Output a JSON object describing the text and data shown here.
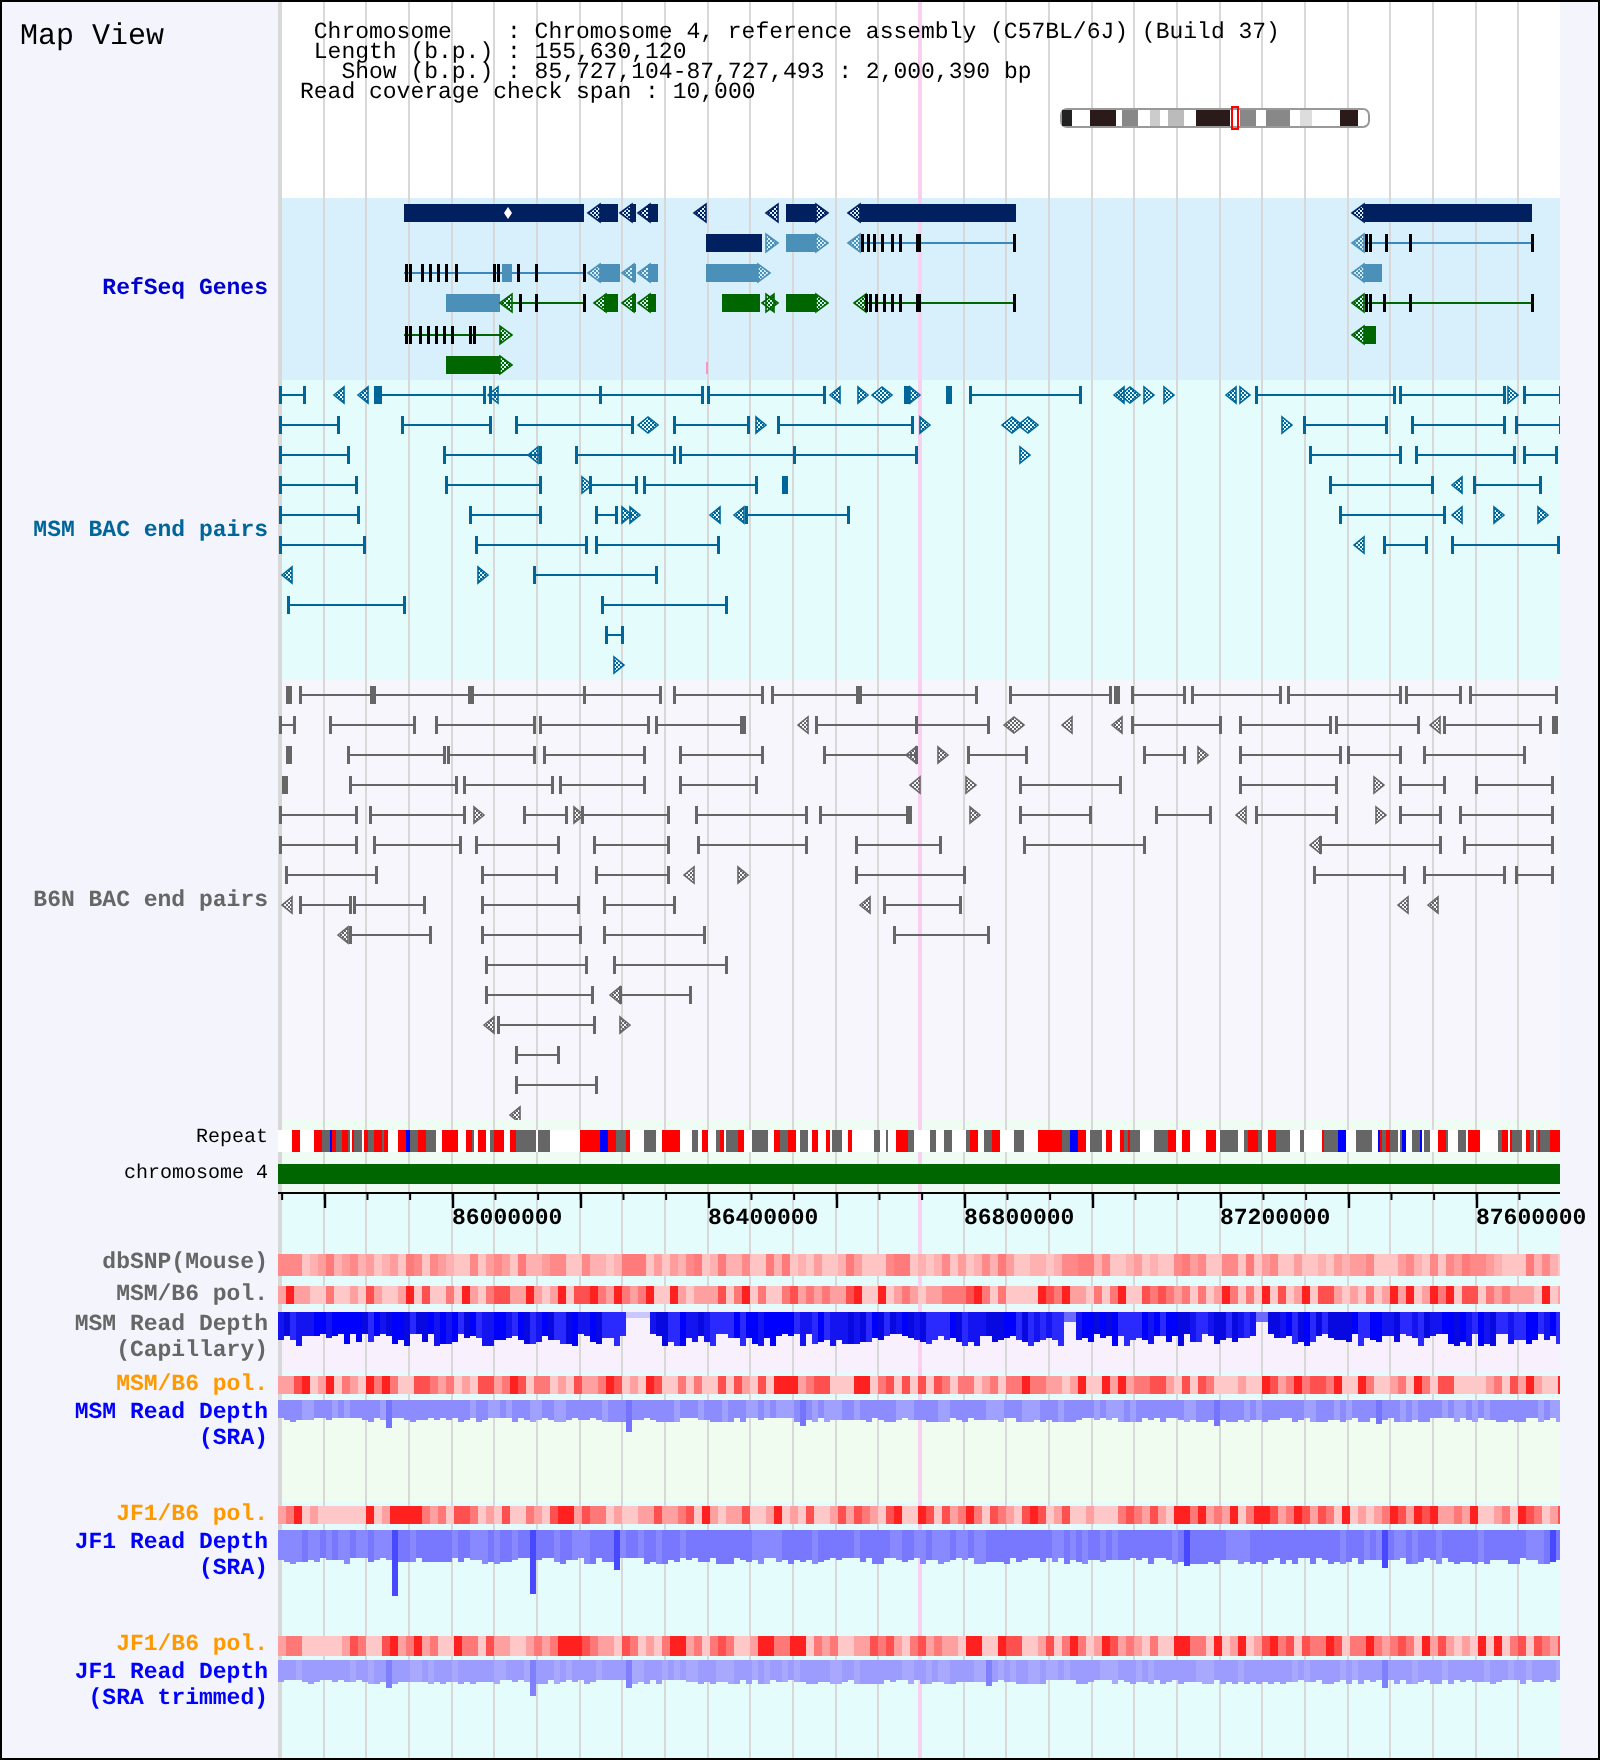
{
  "title": "Map View",
  "info": [
    {
      "label": "Chromosome",
      "value": ": Chromosome 4, reference assembly (C57BL/6J) (Build 37)"
    },
    {
      "label": "Length (b.p.)",
      "value": ": 155,630,120"
    },
    {
      "label": "Show (b.p.)",
      "value": ": 85,727,104-87,727,493 : 2,000,390 bp"
    },
    {
      "label": "Read coverage check span",
      "value": ": 10,000"
    }
  ],
  "feature_tracks": [
    {
      "kind": "genes",
      "label": "RefSeq Genes",
      "color": "#0000cc"
    },
    {
      "kind": "bac_pairs",
      "label": "MSM BAC end pairs",
      "color": "#006699"
    },
    {
      "kind": "bac_pairs",
      "label": "B6N BAC end pairs",
      "color": "#666666"
    }
  ],
  "repeat_track": {
    "label": "Repeat"
  },
  "chromosome_track": {
    "label": "chromosome 4"
  },
  "ruler": {
    "ticks": [
      "86000000",
      "86400000",
      "86800000",
      "87200000",
      "87600000"
    ]
  },
  "data_tracks": [
    {
      "kind": "heatmap",
      "label": [
        "dbSNP(Mouse)"
      ],
      "color": "#666666"
    },
    {
      "kind": "heatmap",
      "label": [
        "MSM/B6 pol."
      ],
      "color": "#666666"
    },
    {
      "kind": "depth",
      "label": [
        "MSM Read Depth",
        "(Capillary)"
      ],
      "color": "#666666"
    },
    {
      "kind": "heatmap",
      "label": [
        "MSM/B6 pol."
      ],
      "color": "#ff9900"
    },
    {
      "kind": "depth",
      "label": [
        "MSM Read Depth",
        "(SRA)"
      ],
      "color": "#0000ff"
    },
    {
      "kind": "heatmap",
      "label": [
        "JF1/B6 pol."
      ],
      "color": "#ff9900"
    },
    {
      "kind": "depth",
      "label": [
        "JF1 Read Depth",
        "(SRA)"
      ],
      "color": "#0000ff"
    },
    {
      "kind": "heatmap",
      "label": [
        "JF1/B6 pol."
      ],
      "color": "#ff9900"
    },
    {
      "kind": "depth",
      "label": [
        "JF1 Read Depth",
        "(SRA trimmed)"
      ],
      "color": "#0000ff"
    }
  ]
}
